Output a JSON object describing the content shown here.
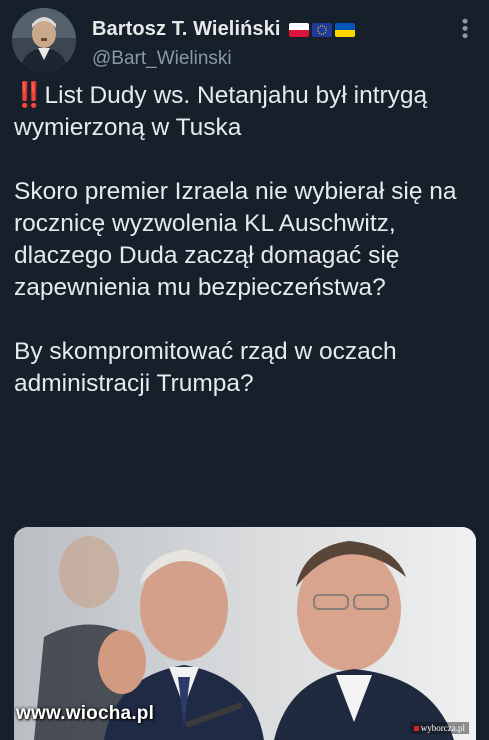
{
  "author": {
    "display_name": "Bartosz T. Wieliński",
    "handle": "@Bart_Wielinski",
    "flags": [
      "poland-flag",
      "eu-flag",
      "ukraine-flag"
    ]
  },
  "tweet": {
    "alert_emoji": "‼️",
    "line1": "List Dudy ws. Netanjahu był intrygą wymierzoną w Tuska",
    "paragraph2": "Skoro premier Izraela nie wybierał się na rocznicę wyzwolenia KL Auschwitz, dlaczego Duda zaczął domagać się zapewnienia mu bezpieczeństwa?",
    "paragraph3": "By skompromitować rząd w oczach administracji Trumpa?"
  },
  "media": {
    "source_badge": "wyborcza.pl",
    "watermark": "www.wiocha.pl"
  },
  "colors": {
    "background": "#15202b",
    "text": "#e7e9ea",
    "secondary": "#8b98a5"
  }
}
